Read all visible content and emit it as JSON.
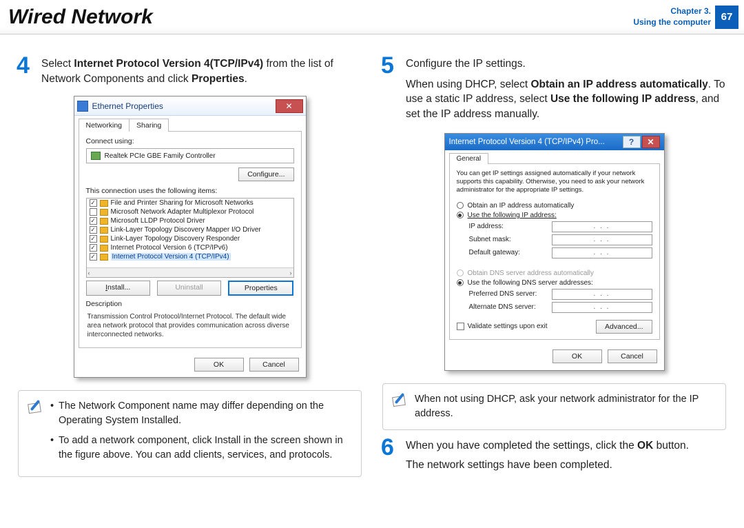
{
  "header": {
    "title": "Wired Network",
    "chapter_line1": "Chapter 3.",
    "chapter_line2": "Using the computer",
    "page_number": "67"
  },
  "step4": {
    "number": "4",
    "text_pre": "Select ",
    "text_bold1": "Internet Protocol Version 4(TCP/IPv4)",
    "text_mid": " from the list of Network Components and click ",
    "text_bold2": "Properties",
    "text_post": "."
  },
  "eth_dialog": {
    "title": "Ethernet Properties",
    "close": "✕",
    "tab_networking": "Networking",
    "tab_sharing": "Sharing",
    "connect_using_label": "Connect using:",
    "adapter": "Realtek PCIe GBE Family Controller",
    "configure_btn": "Configure...",
    "items_label": "This connection uses the following items:",
    "components": [
      {
        "checked": true,
        "label": "File and Printer Sharing for Microsoft Networks"
      },
      {
        "checked": false,
        "label": "Microsoft Network Adapter Multiplexor Protocol"
      },
      {
        "checked": true,
        "label": "Microsoft LLDP Protocol Driver"
      },
      {
        "checked": true,
        "label": "Link-Layer Topology Discovery Mapper I/O Driver"
      },
      {
        "checked": true,
        "label": "Link-Layer Topology Discovery Responder"
      },
      {
        "checked": true,
        "label": "Internet Protocol Version 6 (TCP/IPv6)"
      },
      {
        "checked": true,
        "label": "Internet Protocol Version 4 (TCP/IPv4)",
        "selected": true
      }
    ],
    "install_btn": "Install...",
    "uninstall_btn": "Uninstall",
    "properties_btn": "Properties",
    "description_label": "Description",
    "description_text": "Transmission Control Protocol/Internet Protocol. The default wide area network protocol that provides communication across diverse interconnected networks.",
    "ok_btn": "OK",
    "cancel_btn": "Cancel"
  },
  "note1": {
    "bullet1": "The Network Component name may differ depending on the Operating System Installed.",
    "bullet2": "To add a network component, click Install in the screen shown in the figure above. You can add clients, services, and protocols."
  },
  "step5": {
    "number": "5",
    "line1": "Configure the IP settings.",
    "line2_pre": "When using DHCP, select ",
    "line2_b1": "Obtain an IP address automatically",
    "line2_mid": ". To use a static IP address, select ",
    "line2_b2": "Use the following IP address",
    "line2_post": ", and set the IP address manually."
  },
  "ip_dialog": {
    "title": "Internet Protocol Version 4 (TCP/IPv4) Pro...",
    "help": "?",
    "close": "✕",
    "tab_general": "General",
    "intro": "You can get IP settings assigned automatically if your network supports this capability. Otherwise, you need to ask your network administrator for the appropriate IP settings.",
    "radio_auto_ip": "Obtain an IP address automatically",
    "radio_use_ip": "Use the following IP address:",
    "ip_address_label": "IP address:",
    "subnet_label": "Subnet mask:",
    "gateway_label": "Default gateway:",
    "radio_auto_dns": "Obtain DNS server address automatically",
    "radio_use_dns": "Use the following DNS server addresses:",
    "pref_dns_label": "Preferred DNS server:",
    "alt_dns_label": "Alternate DNS server:",
    "validate_label": "Validate settings upon exit",
    "advanced_btn": "Advanced...",
    "ok_btn": "OK",
    "cancel_btn": "Cancel",
    "dots": ".   .   ."
  },
  "note2": {
    "text": "When not using DHCP, ask your network administrator for the IP address."
  },
  "step6": {
    "number": "6",
    "line1_pre": "When you have completed the settings, click the ",
    "line1_b": "OK",
    "line1_post": " button.",
    "line2": "The network settings have been completed."
  }
}
